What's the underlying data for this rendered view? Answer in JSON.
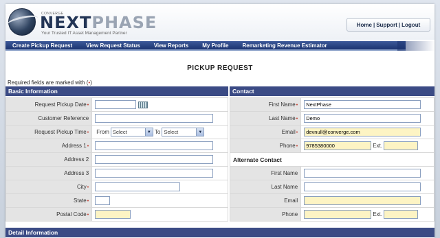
{
  "header": {
    "logo_small": "CONVERGE",
    "logo_main": "NEXT",
    "logo_accent": "PHASE",
    "tagline": "Your Trusted IT Asset Management Partner",
    "links": [
      "Home",
      "Support",
      "Logout"
    ],
    "separator": "|"
  },
  "nav": [
    "Create Pickup Request",
    "View Request Status",
    "View Reports",
    "My Profile",
    "Remarketing Revenue Estimator"
  ],
  "page": {
    "title": "PICKUP REQUEST",
    "required_note_prefix": "Required fields are marked with (",
    "required_mark": "•",
    "required_note_suffix": ")"
  },
  "basic": {
    "heading": "Basic Information",
    "labels": {
      "pickup_date": "Request Pickup Date",
      "customer_ref": "Customer Reference",
      "pickup_time": "Request Pickup Time",
      "address1": "Address 1",
      "address2": "Address 2",
      "address3": "Address 3",
      "city": "City",
      "state": "State",
      "postal": "Postal Code"
    },
    "time_from": "From",
    "time_to": "To",
    "select_placeholder": "Select"
  },
  "contact": {
    "heading": "Contact",
    "labels": {
      "first_name": "First Name",
      "last_name": "Last Name",
      "email": "Email",
      "phone": "Phone"
    },
    "values": {
      "first_name": "NextPhase",
      "last_name": "Demo",
      "email": "devnull@converge.com",
      "phone": "9785380000"
    },
    "ext_label": "Ext.",
    "alternate": {
      "heading": "Alternate Contact",
      "labels": {
        "first_name": "First Name",
        "last_name": "Last Name",
        "email": "Email",
        "phone": "Phone"
      }
    }
  },
  "detail": {
    "heading": "Detail Information"
  },
  "colors": {
    "nav_bg": "#1c3470",
    "section_header_bg": "#3b4b85",
    "required_mark": "#c0392b",
    "highlight_input": "#fdf4c4"
  },
  "icons": {
    "logo": "globe-logo",
    "calendar": "calendar-icon",
    "dropdown": "chevron-down-icon"
  }
}
